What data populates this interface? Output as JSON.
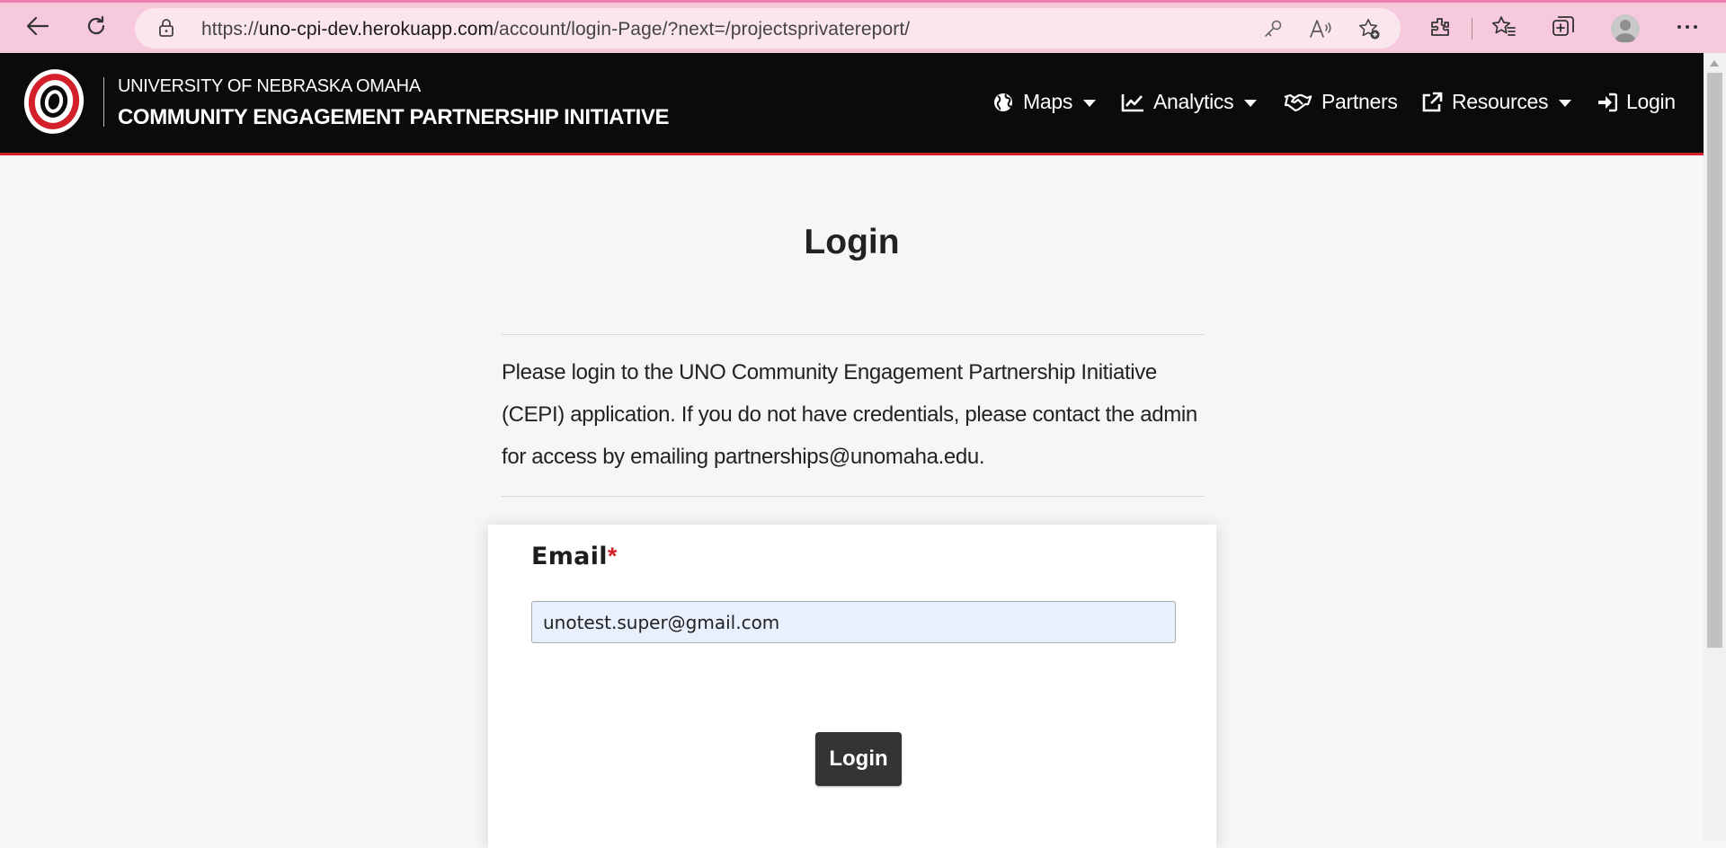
{
  "browser": {
    "url_prefix": "https://",
    "url_host": "uno-cpi-dev.herokuapp.com",
    "url_path": "/account/login-Page/?next=/projectsprivatereport/",
    "icons": [
      "back-icon",
      "refresh-icon",
      "lock-icon",
      "key-icon",
      "read-aloud-icon",
      "add-favorite-icon",
      "extensions-icon",
      "favorites-icon",
      "collections-icon",
      "profile-icon",
      "more-icon"
    ]
  },
  "header": {
    "university": "UNIVERSITY OF NEBRASKA OMAHA",
    "program": "COMMUNITY ENGAGEMENT PARTNERSHIP INITIATIVE",
    "nav": {
      "maps": "Maps",
      "analytics": "Analytics",
      "partners": "Partners",
      "resources": "Resources",
      "login": "Login"
    },
    "accent_color": "#d4202a"
  },
  "main": {
    "title": "Login",
    "intro": "Please login to the UNO Community Engagement Partnership Initiative (CEPI) application. If you do not have credentials, please contact the admin for access by emailing partnerships@unomaha.edu.",
    "form": {
      "email_label": "Email",
      "required_mark": "*",
      "email_value": "unotest.super@gmail.com",
      "submit_label": "Login"
    }
  }
}
